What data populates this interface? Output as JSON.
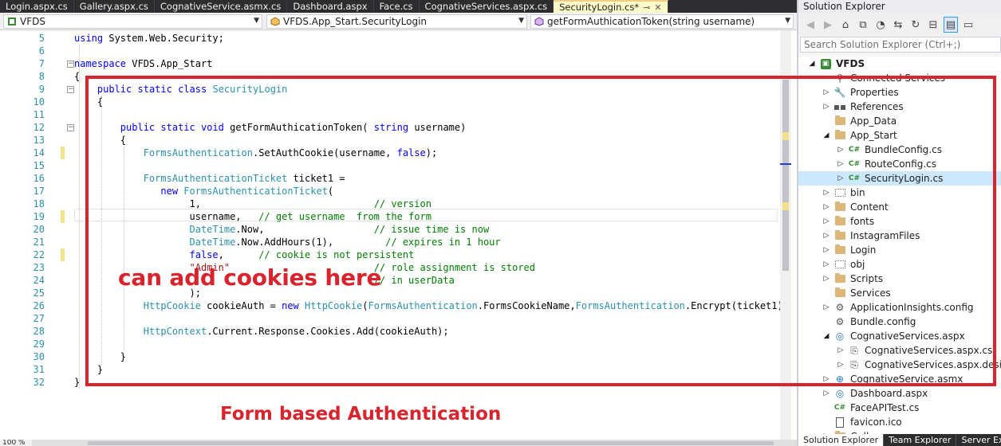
{
  "tabs": [
    {
      "label": "Login.aspx.cs",
      "active": false
    },
    {
      "label": "Gallery.aspx.cs",
      "active": false
    },
    {
      "label": "CognativeService.asmx.cs",
      "active": false
    },
    {
      "label": "Dashboard.aspx",
      "active": false
    },
    {
      "label": "Face.cs",
      "active": false
    },
    {
      "label": "CognativeServices.aspx.cs",
      "active": false
    },
    {
      "label": "SecurityLogin.cs*",
      "active": true
    }
  ],
  "navbar": {
    "project": "VFDS",
    "class": "VFDS.App_Start.SecurityLogin",
    "member": "getFormAuthicationToken(string username)"
  },
  "editor": {
    "lines": [
      {
        "n": 5,
        "code": "using System.Web.Security;"
      },
      {
        "n": 6,
        "code": ""
      },
      {
        "n": 7,
        "code": "namespace VFDS.App_Start"
      },
      {
        "n": 8,
        "code": "{"
      },
      {
        "n": 9,
        "code": "    public static class SecurityLogin"
      },
      {
        "n": 10,
        "code": "    {"
      },
      {
        "n": 11,
        "code": ""
      },
      {
        "n": 12,
        "code": "        public static void getFormAuthicationToken( string username)"
      },
      {
        "n": 13,
        "code": "        {"
      },
      {
        "n": 14,
        "code": "            FormsAuthentication.SetAuthCookie(username, false);"
      },
      {
        "n": 15,
        "code": ""
      },
      {
        "n": 16,
        "code": "            FormsAuthenticationTicket ticket1 ="
      },
      {
        "n": 17,
        "code": "               new FormsAuthenticationTicket("
      },
      {
        "n": 18,
        "code": "                    1,                              // version"
      },
      {
        "n": 19,
        "code": "                    username,   // get username  from the form"
      },
      {
        "n": 20,
        "code": "                    DateTime.Now,                   // issue time is now"
      },
      {
        "n": 21,
        "code": "                    DateTime.Now.AddHours(1),         // expires in 1 hour"
      },
      {
        "n": 22,
        "code": "                    false,      // cookie is not persistent"
      },
      {
        "n": 23,
        "code": "                    \"Admin\"                         // role assignment is stored"
      },
      {
        "n": 24,
        "code": "                                                    // in userData"
      },
      {
        "n": 25,
        "code": "                    );"
      },
      {
        "n": 26,
        "code": "            HttpCookie cookieAuth = new HttpCookie(FormsAuthentication.FormsCookieName,FormsAuthentication.Encrypt(ticket1));"
      },
      {
        "n": 27,
        "code": ""
      },
      {
        "n": 28,
        "code": "            HttpContext.Current.Response.Cookies.Add(cookieAuth);"
      },
      {
        "n": 29,
        "code": ""
      },
      {
        "n": 30,
        "code": "        }"
      },
      {
        "n": 31,
        "code": "    }"
      },
      {
        "n": 32,
        "code": "}"
      }
    ],
    "zoom": "100 %"
  },
  "annotations": {
    "cookies": "can add cookies here",
    "form_auth": "Form based Authentication"
  },
  "solution_explorer": {
    "title": "Solution Explorer",
    "search_placeholder": "Search Solution Explorer (Ctrl+;)",
    "items": [
      {
        "label": "VFDS",
        "depth": 0,
        "expander": "open",
        "icon": "project-icon",
        "bold": true
      },
      {
        "label": "Connected Services",
        "depth": 1,
        "expander": "none",
        "icon": "connected-services-icon"
      },
      {
        "label": "Properties",
        "depth": 1,
        "expander": "closed",
        "icon": "wrench-icon"
      },
      {
        "label": "References",
        "depth": 1,
        "expander": "closed",
        "icon": "references-icon"
      },
      {
        "label": "App_Data",
        "depth": 1,
        "expander": "none",
        "icon": "folder-icon"
      },
      {
        "label": "App_Start",
        "depth": 1,
        "expander": "open",
        "icon": "folder-icon"
      },
      {
        "label": "BundleConfig.cs",
        "depth": 2,
        "expander": "closed",
        "icon": "csharp-file-icon"
      },
      {
        "label": "RouteConfig.cs",
        "depth": 2,
        "expander": "closed",
        "icon": "csharp-file-icon"
      },
      {
        "label": "SecurityLogin.cs",
        "depth": 2,
        "expander": "closed",
        "icon": "csharp-file-icon",
        "selected": true
      },
      {
        "label": "bin",
        "depth": 1,
        "expander": "closed",
        "icon": "hidden-folder-icon"
      },
      {
        "label": "Content",
        "depth": 1,
        "expander": "closed",
        "icon": "folder-icon"
      },
      {
        "label": "fonts",
        "depth": 1,
        "expander": "closed",
        "icon": "folder-icon"
      },
      {
        "label": "InstagramFiles",
        "depth": 1,
        "expander": "closed",
        "icon": "folder-icon"
      },
      {
        "label": "Login",
        "depth": 1,
        "expander": "closed",
        "icon": "folder-icon"
      },
      {
        "label": "obj",
        "depth": 1,
        "expander": "closed",
        "icon": "hidden-folder-icon"
      },
      {
        "label": "Scripts",
        "depth": 1,
        "expander": "closed",
        "icon": "folder-icon"
      },
      {
        "label": "Services",
        "depth": 1,
        "expander": "none",
        "icon": "folder-icon"
      },
      {
        "label": "ApplicationInsights.config",
        "depth": 1,
        "expander": "closed",
        "icon": "config-file-icon"
      },
      {
        "label": "Bundle.config",
        "depth": 1,
        "expander": "none",
        "icon": "config-file-icon"
      },
      {
        "label": "CognativeServices.aspx",
        "depth": 1,
        "expander": "open",
        "icon": "web-page-icon"
      },
      {
        "label": "CognativeServices.aspx.cs",
        "depth": 2,
        "expander": "closed",
        "icon": "code-file-icon"
      },
      {
        "label": "CognativeServices.aspx.designer.cs",
        "depth": 2,
        "expander": "closed",
        "icon": "code-file-icon"
      },
      {
        "label": "CognativeService.asmx",
        "depth": 1,
        "expander": "closed",
        "icon": "web-service-icon"
      },
      {
        "label": "Dashboard.aspx",
        "depth": 1,
        "expander": "closed",
        "icon": "web-page-icon"
      },
      {
        "label": "FaceAPITest.cs",
        "depth": 1,
        "expander": "none",
        "icon": "csharp-file-icon"
      },
      {
        "label": "favicon.ico",
        "depth": 1,
        "expander": "none",
        "icon": "file-icon"
      },
      {
        "label": "Gallery",
        "depth": 1,
        "expander": "closed",
        "icon": "folder-icon"
      }
    ],
    "tabs": [
      "Solution Explorer",
      "Team Explorer",
      "Server Explorer"
    ]
  },
  "colors": {
    "annotation_red": "#d9232d",
    "keyword": "#0000ff",
    "type": "#2b91af",
    "comment": "#008000",
    "string": "#a31515",
    "selection": "#cce8ff"
  }
}
